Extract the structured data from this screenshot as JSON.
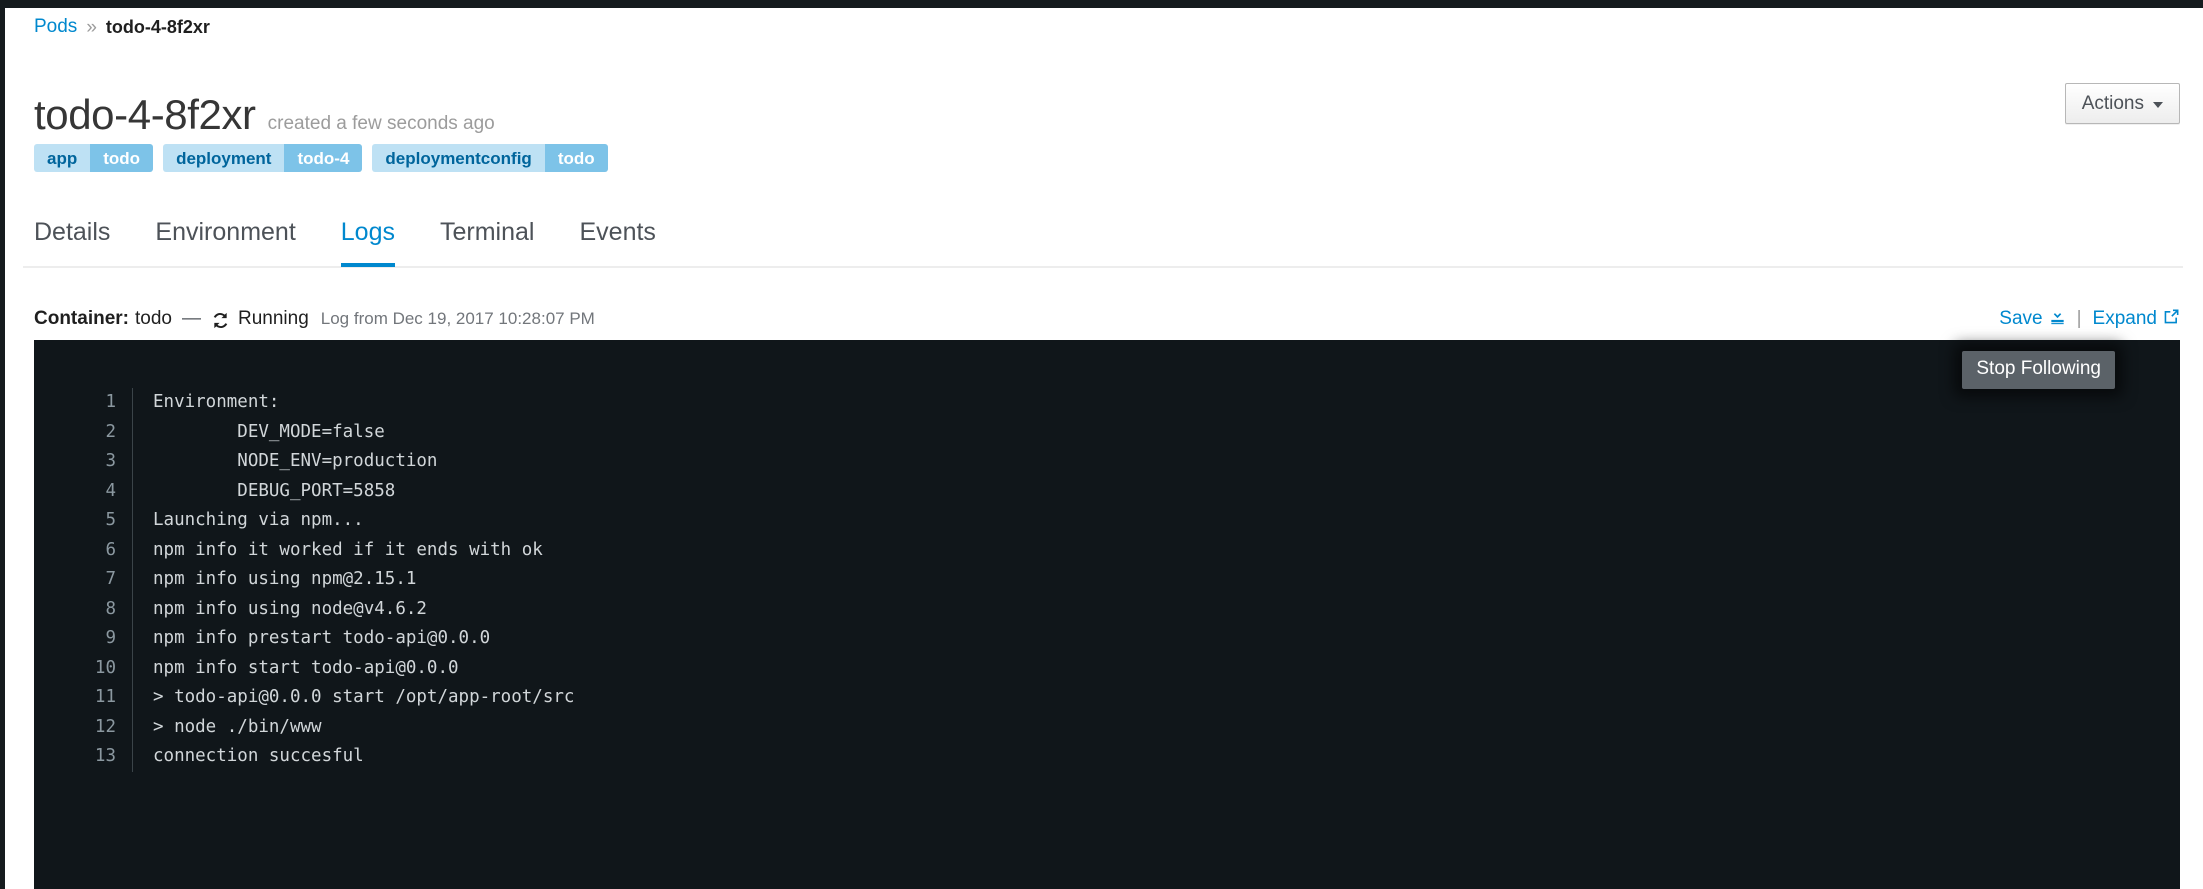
{
  "colors": {
    "link": "#0088ce",
    "label_key_bg": "#bee1f4",
    "label_key_text": "#00659c",
    "label_val_bg": "#7dc3e8",
    "log_bg": "#10161a",
    "chrome_dark": "#151b1e",
    "tooltip_bg": "#5b6268"
  },
  "breadcrumb": {
    "parent": "Pods",
    "separator": "»",
    "current": "todo-4-8f2xr"
  },
  "header": {
    "title": "todo-4-8f2xr",
    "subtitle": "created a few seconds ago",
    "actions_label": "Actions"
  },
  "labels": [
    {
      "key": "app",
      "value": "todo"
    },
    {
      "key": "deployment",
      "value": "todo-4"
    },
    {
      "key": "deploymentconfig",
      "value": "todo"
    }
  ],
  "tabs": [
    {
      "label": "Details",
      "active": false
    },
    {
      "label": "Environment",
      "active": false
    },
    {
      "label": "Logs",
      "active": true
    },
    {
      "label": "Terminal",
      "active": false
    },
    {
      "label": "Events",
      "active": false
    }
  ],
  "status": {
    "container_label": "Container:",
    "container_name": "todo",
    "dash": "—",
    "state": "Running",
    "log_from": "Log from Dec 19, 2017 10:28:07 PM",
    "save_label": "Save",
    "divider": "|",
    "expand_label": "Expand"
  },
  "log_viewer": {
    "stop_following_label": "Stop Following",
    "lines": [
      {
        "n": "1",
        "text": "Environment:"
      },
      {
        "n": "2",
        "text": "        DEV_MODE=false"
      },
      {
        "n": "3",
        "text": "        NODE_ENV=production"
      },
      {
        "n": "4",
        "text": "        DEBUG_PORT=5858"
      },
      {
        "n": "5",
        "text": "Launching via npm..."
      },
      {
        "n": "6",
        "text": "npm info it worked if it ends with ok"
      },
      {
        "n": "7",
        "text": "npm info using npm@2.15.1"
      },
      {
        "n": "8",
        "text": "npm info using node@v4.6.2"
      },
      {
        "n": "9",
        "text": "npm info prestart todo-api@0.0.0"
      },
      {
        "n": "10",
        "text": "npm info start todo-api@0.0.0"
      },
      {
        "n": "11",
        "text": "> todo-api@0.0.0 start /opt/app-root/src"
      },
      {
        "n": "12",
        "text": "> node ./bin/www"
      },
      {
        "n": "13",
        "text": "connection succesful"
      }
    ]
  }
}
